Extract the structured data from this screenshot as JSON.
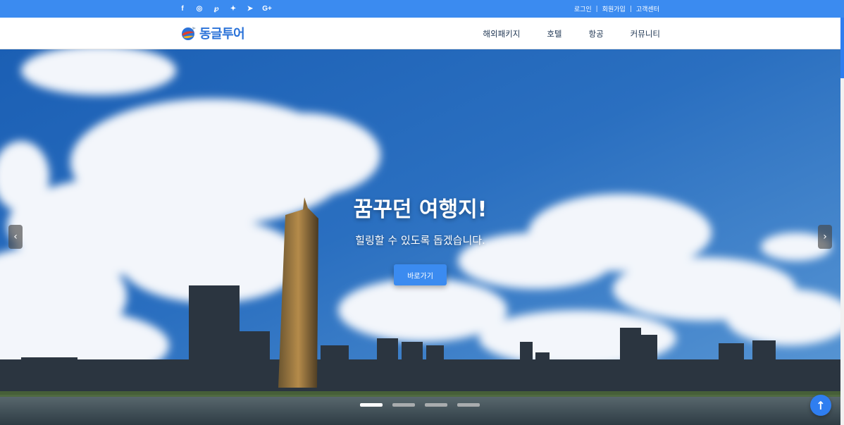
{
  "topbar": {
    "social": [
      {
        "icon": "facebook-icon",
        "glyph": "f"
      },
      {
        "icon": "instagram-icon",
        "glyph": "◎"
      },
      {
        "icon": "pinterest-icon",
        "glyph": "℘"
      },
      {
        "icon": "twitter-icon",
        "glyph": "✦"
      },
      {
        "icon": "telegram-icon",
        "glyph": "➤"
      },
      {
        "icon": "google-plus-icon",
        "glyph": "G+"
      }
    ],
    "login": "로그인",
    "signup": "회원가입",
    "support": "고객센터",
    "separator": "|"
  },
  "header": {
    "logo_text": "동글투어",
    "nav": [
      "해외패키지",
      "호텔",
      "항공",
      "커뮤니티"
    ]
  },
  "hero": {
    "title": "꿈꾸던 여행지!",
    "subtitle": "힐링할 수 있도록 돕겠습니다.",
    "button_label": "바로가기",
    "prev_glyph": "‹",
    "next_glyph": "›",
    "slide_count": 4,
    "active_slide": 1
  },
  "scroll_top_glyph": "↑",
  "colors": {
    "accent": "#3b8bf0",
    "nav_text": "#1e3552",
    "logo_blue": "#2a72d8"
  }
}
